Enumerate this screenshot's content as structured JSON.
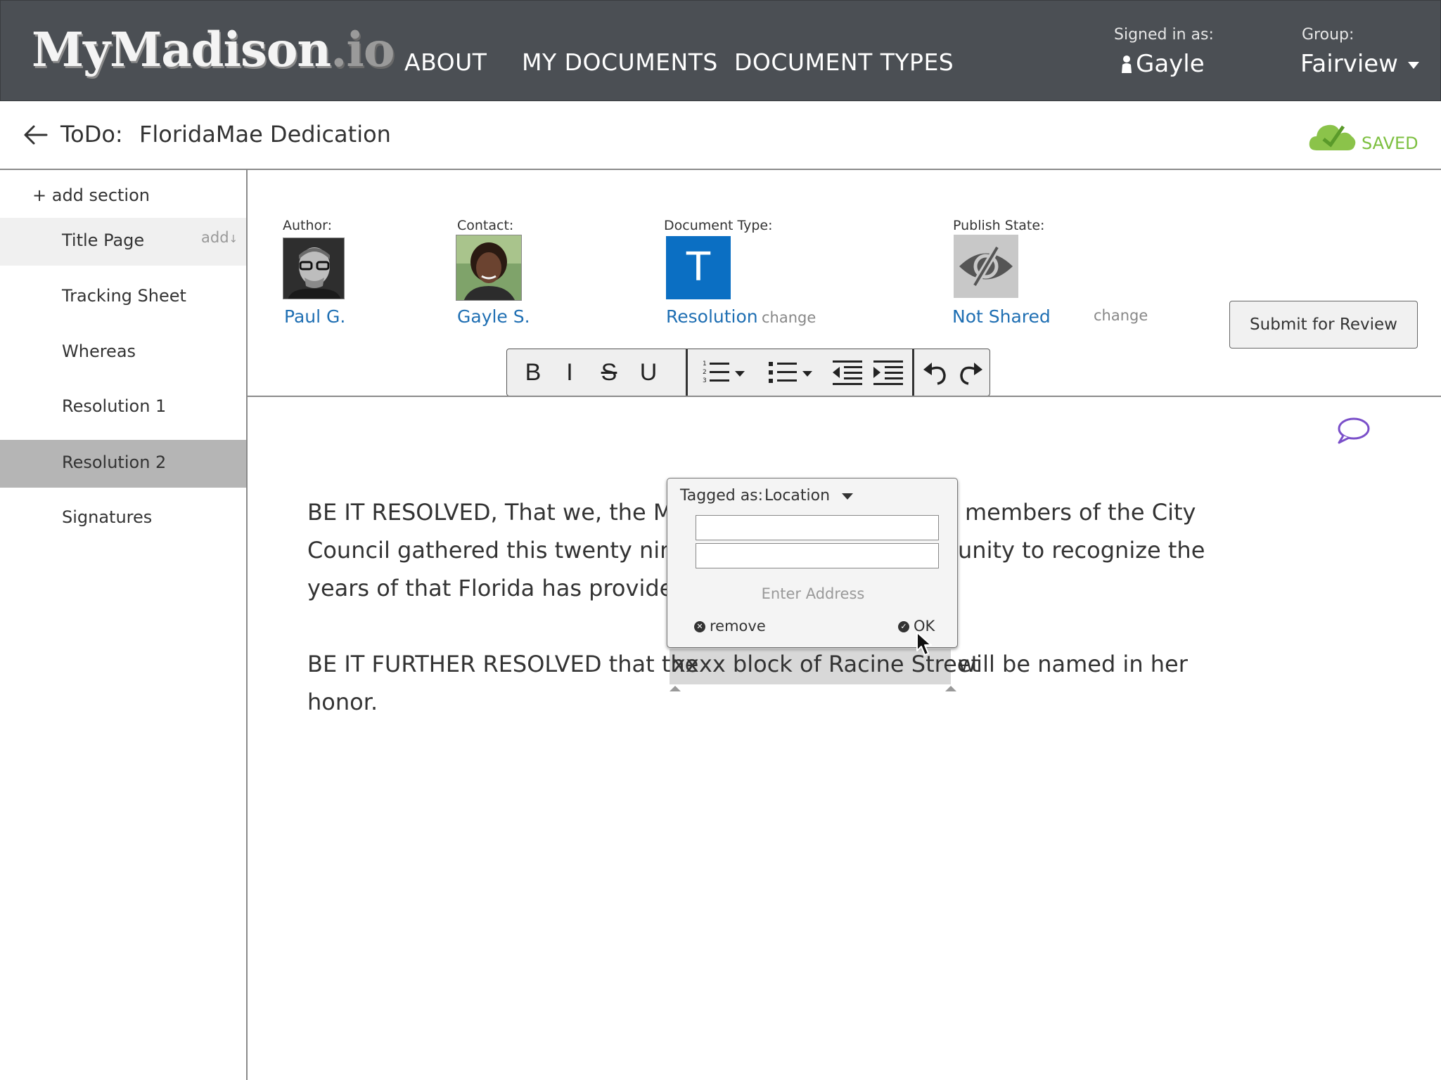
{
  "header": {
    "logo_main": "MyMadison",
    "logo_suffix": ".io",
    "nav": [
      "ABOUT",
      "MY DOCUMENTS",
      "DOCUMENT TYPES"
    ],
    "signed_in_label": "Signed in as:",
    "user_name": "Gayle",
    "group_label": "Group:",
    "group_value": "Fairview"
  },
  "titlebar": {
    "todo_label": "ToDo:",
    "doc_title": "FloridaMae Dedication",
    "saved_text": "SAVED"
  },
  "sidebar": {
    "add_section": "+ add section",
    "add_inline": "add",
    "items": [
      "Title Page",
      "Tracking Sheet",
      "Whereas",
      "Resolution 1",
      "Resolution 2",
      "Signatures"
    ],
    "active_item": "Resolution 2"
  },
  "meta": {
    "author_label": "Author:",
    "author_name": "Paul G.",
    "contact_label": "Contact:",
    "contact_name": "Gayle S.",
    "doctype_label": "Document Type:",
    "doctype_letter": "T",
    "doctype_value": "Resolution",
    "publish_label": "Publish State:",
    "publish_value": "Not Shared",
    "change_label": "change",
    "submit_label": "Submit for Review"
  },
  "toolbar": {
    "bold": "B",
    "italic": "I",
    "strike": "S",
    "underline": "U"
  },
  "document": {
    "para1_line1_a": "BE IT RESOLVED, That we, the May",
    "para1_line1_b": "members of the City",
    "para1_line2_a": "Council gathered this twenty ninth",
    "para1_line2_b": "unity to recognize the",
    "para1_line3_a": "years of that Florida has provided",
    "para2_line1_a": "BE IT FURTHER RESOLVED that the",
    "para2_tagged": "xxxx block of Racine Street",
    "para2_line1_b": "will be named in her",
    "para2_line2": "honor."
  },
  "tag_popover": {
    "label": "Tagged as:",
    "selected": "Location",
    "input1_value": "",
    "input2_value": "",
    "address_placeholder": "Enter Address",
    "remove_label": "remove",
    "ok_label": "OK"
  },
  "colors": {
    "topbar": "#4b4f54",
    "link": "#1f6fb3",
    "saved": "#7cbf3f",
    "doctype_tile": "#0b6fc3",
    "comment_icon": "#7a4fc9"
  }
}
